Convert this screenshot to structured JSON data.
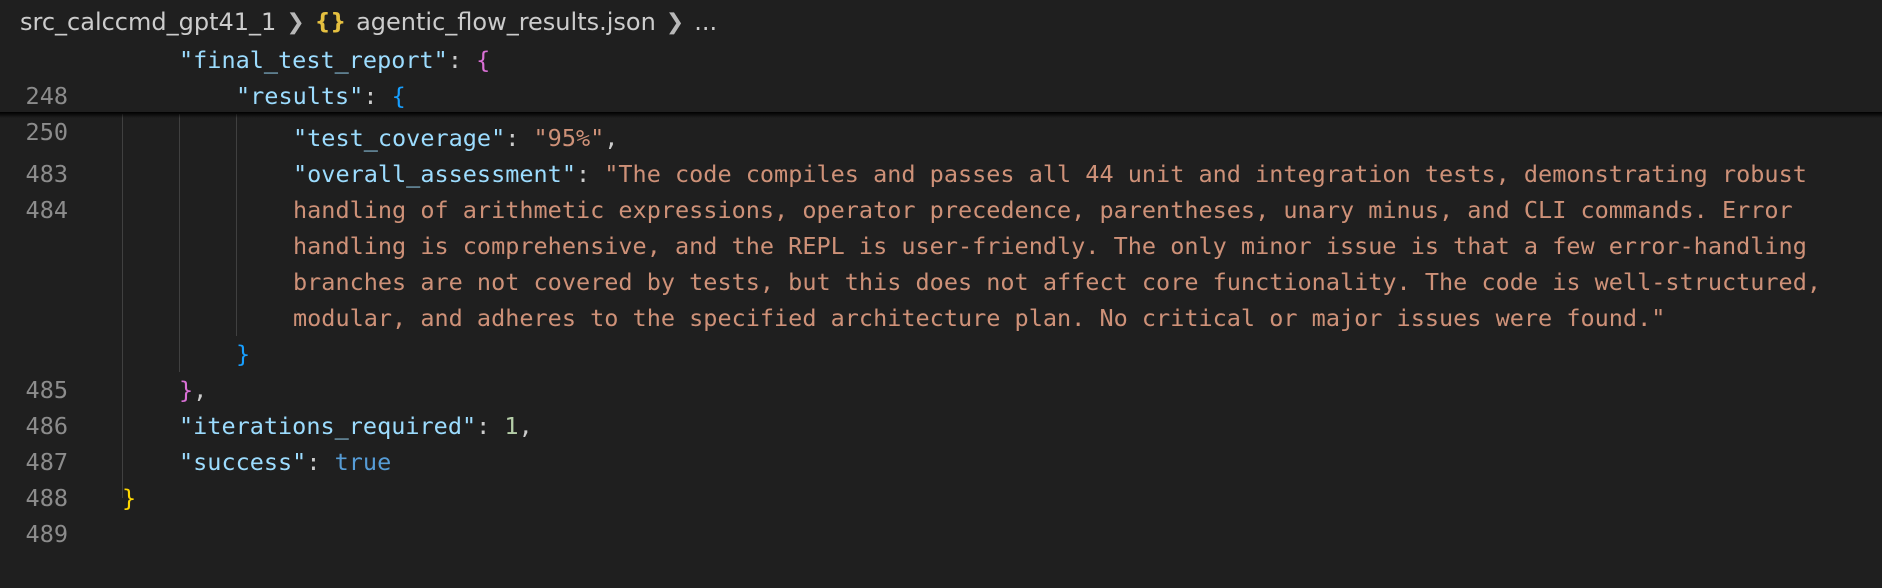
{
  "breadcrumb": {
    "folder": "src_calccmd_gpt41_1",
    "file_icon": "{}",
    "file": "agentic_flow_results.json",
    "more": "..."
  },
  "sticky_lines": [
    {
      "number": "248",
      "key": "\"final_test_report\"",
      "colon": ": ",
      "bracket": "{"
    },
    {
      "number": "250",
      "key": "\"results\"",
      "colon": ": ",
      "bracket": "{"
    }
  ],
  "lines": {
    "l483": {
      "number": "483",
      "key": "\"test_coverage\"",
      "colon": ": ",
      "value": "\"95%\"",
      "comma": ","
    },
    "l484": {
      "number": "484",
      "key": "\"overall_assessment\"",
      "colon": ": ",
      "value_wrapped": [
        "\"The code compiles and passes all 44 unit and integration tests, demonstrating robust",
        "handling of arithmetic expressions, operator precedence, parentheses, unary minus, and CLI commands. Error",
        "handling is comprehensive, and the REPL is user-friendly. The only minor issue is that a few error-handling",
        "branches are not covered by tests, but this does not affect core functionality. The code is well-structured,",
        "modular, and adheres to the specified architecture plan. No critical or major issues were found.\""
      ]
    },
    "l485": {
      "number": "485",
      "bracket": "}"
    },
    "l486": {
      "number": "486",
      "bracket": "}",
      "comma": ","
    },
    "l487": {
      "number": "487",
      "key": "\"iterations_required\"",
      "colon": ": ",
      "value": "1",
      "comma": ","
    },
    "l488": {
      "number": "488",
      "key": "\"success\"",
      "colon": ": ",
      "value": "true"
    },
    "l489": {
      "number": "489",
      "bracket": "}"
    }
  },
  "colors": {
    "background": "#1f1f1f",
    "key": "#9cdcfe",
    "string": "#ce9178",
    "number": "#b5cea8",
    "keyword": "#569cd6",
    "bracket_level1": "#ffd700",
    "bracket_level2": "#da70d6",
    "bracket_level3": "#179fff",
    "line_number": "#8c8c8c"
  }
}
